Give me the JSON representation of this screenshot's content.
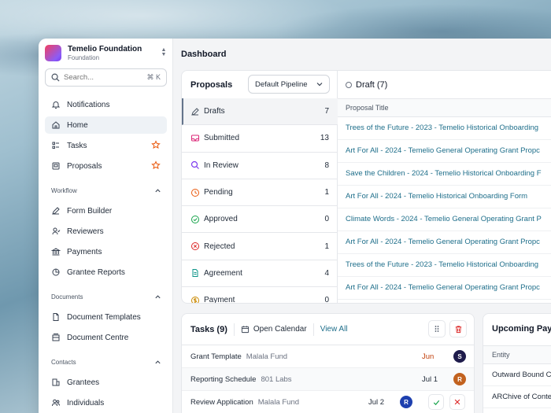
{
  "org": {
    "name": "Temelio Foundation",
    "sub": "Foundation"
  },
  "search": {
    "placeholder": "Search...",
    "shortcut": "⌘ K"
  },
  "nav": {
    "notifications": "Notifications",
    "home": "Home",
    "tasks": "Tasks",
    "proposals": "Proposals",
    "workflow_section": "Workflow",
    "form_builder": "Form Builder",
    "reviewers": "Reviewers",
    "payments": "Payments",
    "grantee_reports": "Grantee Reports",
    "documents_section": "Documents",
    "document_templates": "Document Templates",
    "document_centre": "Document Centre",
    "contacts_section": "Contacts",
    "grantees": "Grantees",
    "individuals": "Individuals"
  },
  "page_title": "Dashboard",
  "proposals": {
    "title": "Proposals",
    "pipeline": "Default Pipeline",
    "statuses": [
      {
        "label": "Drafts",
        "count": "7",
        "icon": "pencil-icon",
        "color": "#4b5563"
      },
      {
        "label": "Submitted",
        "count": "13",
        "icon": "inbox-icon",
        "color": "#db2777"
      },
      {
        "label": "In Review",
        "count": "8",
        "icon": "magnifier-icon",
        "color": "#7c3aed"
      },
      {
        "label": "Pending",
        "count": "1",
        "icon": "clock-icon",
        "color": "#ea580c"
      },
      {
        "label": "Approved",
        "count": "0",
        "icon": "check-circle-icon",
        "color": "#16a34a"
      },
      {
        "label": "Rejected",
        "count": "1",
        "icon": "x-circle-icon",
        "color": "#dc2626"
      },
      {
        "label": "Agreement",
        "count": "4",
        "icon": "document-icon",
        "color": "#0d9488"
      },
      {
        "label": "Payment",
        "count": "0",
        "icon": "dollar-icon",
        "color": "#ca8a04"
      }
    ]
  },
  "drafts": {
    "title": "Draft (7)",
    "column": "Proposal Title",
    "rows": [
      "Trees of the Future - 2023 - Temelio Historical Onboarding",
      "Art For All - 2024 - Temelio General Operating Grant Propc",
      "Save the Children - 2024 - Temelio Historical Onboarding F",
      "Art For All - 2024 - Temelio Historical Onboarding Form",
      "Climate Words - 2024 - Temelio General Operating Grant P",
      "Art For All - 2024 - Temelio General Operating Grant Propc",
      "Trees of the Future - 2023 - Temelio Historical Onboarding",
      "Art For All - 2024 - Temelio General Operating Grant Propc"
    ]
  },
  "tasks": {
    "title": "Tasks (9)",
    "open_calendar": "Open Calendar",
    "view_all": "View All",
    "rows": [
      {
        "name": "Grant Template",
        "org": "Malala Fund",
        "date": "Jun",
        "date_color": "#c2410c",
        "avatar": "S",
        "avatar_color": "#1e1b4b"
      },
      {
        "name": "Reporting Schedule",
        "org": "801 Labs",
        "date": "Jul 1",
        "date_color": "#1f2937",
        "avatar": "R",
        "avatar_color": "#c2621f"
      },
      {
        "name": "Review Application",
        "org": "Malala Fund",
        "date": "Jul 2",
        "date_color": "#1f2937",
        "avatar": "R",
        "avatar_color": "#1e40af"
      }
    ]
  },
  "upcoming": {
    "title": "Upcoming Payments",
    "column": "Entity",
    "rows": [
      "Outward Bound Center",
      "ARChive of Contemporary Music"
    ]
  }
}
